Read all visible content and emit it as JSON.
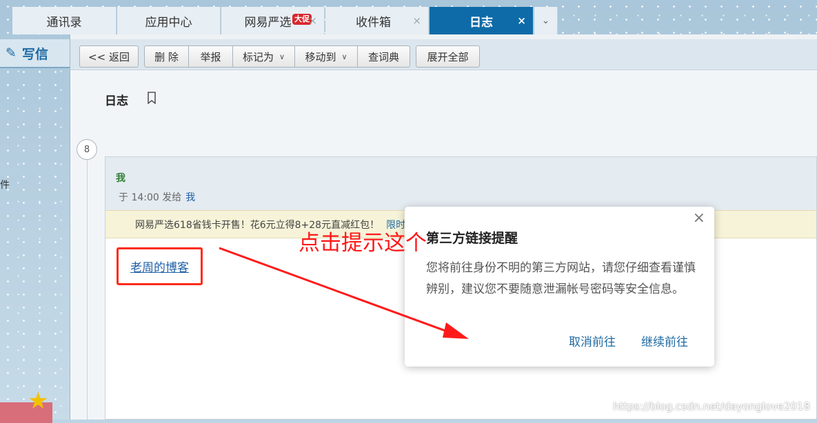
{
  "tabs": [
    {
      "label": "通讯录",
      "active": false
    },
    {
      "label": "应用中心",
      "active": false
    },
    {
      "label": "网易严选",
      "badge": "大促",
      "active": false
    },
    {
      "label": "收件箱",
      "active": false
    },
    {
      "label": "日志",
      "active": true
    }
  ],
  "tab_close_glyph": "×",
  "tab_more_glyph": "⌄",
  "sidebar": {
    "compose_label": "写信",
    "partial_item": "件"
  },
  "toolbar": {
    "back": "<< 返回",
    "delete": "删 除",
    "report": "举报",
    "mark_as": "标记为",
    "move_to": "移动到",
    "dictionary": "查词典",
    "expand_all": "展开全部"
  },
  "mail": {
    "subject": "日志",
    "thread_count": "8",
    "sender": "我",
    "time_prefix": "于 14:00 发给",
    "recipient": "我",
    "ad_text": "网易严选618省钱卡开售！花6元立得8+28元直减红包！",
    "ad_link": "限时抢！>>",
    "body_link": "老周的博客"
  },
  "annotation": {
    "text": "点击提示这个",
    "color": "#ff1a1a"
  },
  "dialog": {
    "title": "第三方链接提醒",
    "body": "您将前往身份不明的第三方网站，请您仔细查看谨慎辨别，建议您不要随意泄漏帐号密码等安全信息。",
    "cancel": "取消前往",
    "continue": "继续前往",
    "close_glyph": "×"
  },
  "watermark": "https://blog.csdn.net/dayonglove2018",
  "colors": {
    "active_tab": "#0e6ba8",
    "link": "#1f5fa6",
    "highlight": "#ff2a1a"
  }
}
